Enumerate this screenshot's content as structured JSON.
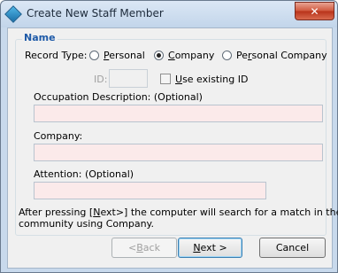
{
  "window": {
    "title": "Create New Staff Member",
    "close_glyph": "✕"
  },
  "group": {
    "title": "Name"
  },
  "record_type": {
    "label": "Record Type:",
    "options": [
      {
        "label": "Personal",
        "selected": false
      },
      {
        "label": "Company",
        "selected": true
      },
      {
        "label": "Personal Company",
        "selected": false
      }
    ]
  },
  "id_row": {
    "label": "ID:",
    "value": "",
    "use_existing_label": "Use existing ID",
    "use_existing_checked": false
  },
  "occupation": {
    "label": "Occupation Description: (Optional)",
    "value": ""
  },
  "company": {
    "label": "Company:",
    "value": ""
  },
  "attention": {
    "label": "Attention:  (Optional)",
    "value": ""
  },
  "info_text": {
    "line1": "After pressing [Next>] the computer will search for a match in the",
    "line2": "community using Company."
  },
  "buttons": {
    "back": "< Back",
    "next": "Next >",
    "cancel": "Cancel"
  },
  "colors": {
    "accent": "#1e5aa8",
    "required_field_bg": "#fbeaea",
    "close_red": "#c8432a"
  }
}
